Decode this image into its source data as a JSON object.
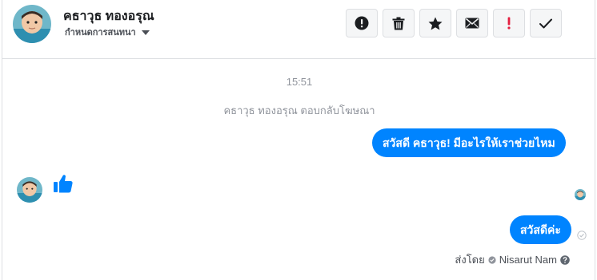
{
  "header": {
    "contact_name": "คธาวุธ ทองอรุณ",
    "conversation_settings": "กำหนดการสนทนา",
    "toolbar": {
      "report_icon": "exclamation-circle-icon",
      "delete_icon": "trash-icon",
      "star_icon": "star-icon",
      "mail_icon": "envelope-icon",
      "spam_icon": "exclamation-icon",
      "done_icon": "checkmark-icon"
    }
  },
  "thread": {
    "timestamp": "15:51",
    "event_text": "คธาวุธ ทองอรุณ ตอบกลับโฆษณา",
    "messages": [
      {
        "direction": "outgoing",
        "text": "สวัสดี คธาวุธ! มีอะไรให้เราช่วยไหม"
      },
      {
        "direction": "incoming",
        "type": "like-sticker"
      },
      {
        "direction": "outgoing",
        "text": "สวัสดีค่ะ"
      }
    ],
    "sent_by_label": "ส่งโดย",
    "sent_by_name": "Nisarut Nam"
  },
  "colors": {
    "accent": "#0084ff",
    "spam_red": "#e41e3f",
    "meta_gray": "#90949c"
  }
}
